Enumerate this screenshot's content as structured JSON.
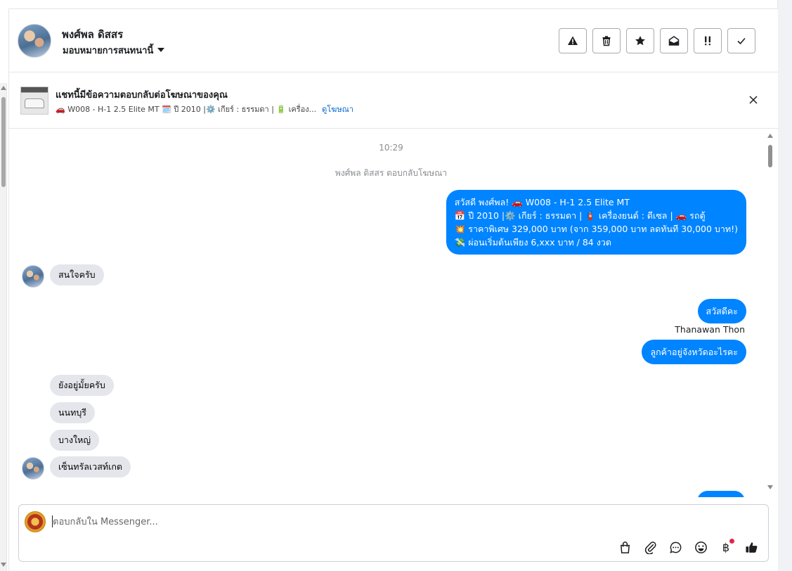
{
  "header": {
    "contact_name": "พงศ์พล ดิสสร",
    "assign_label": "มอบหมายการสนทนานี้",
    "actions": [
      {
        "name": "report-button",
        "icon": "warning-icon"
      },
      {
        "name": "delete-button",
        "icon": "trash-icon"
      },
      {
        "name": "star-button",
        "icon": "star-icon"
      },
      {
        "name": "mark-unread-button",
        "icon": "envelope-open-icon"
      },
      {
        "name": "follow-up-button",
        "icon": "double-exclamation-icon"
      },
      {
        "name": "done-button",
        "icon": "check-icon"
      }
    ]
  },
  "ad": {
    "title": "แชทนี้มีข้อความตอบกลับต่อโฆษณาของคุณ",
    "summary": "🚗 W008 - H-1 2.5 Elite MT 🗓️ ปี 2010 |⚙️ เกียร์ : ธรรมดา | 🔋 เครื่อง...",
    "link": "ดูโฆษณา"
  },
  "chat": {
    "time": "10:29",
    "system_message": "พงศ์พล ดิสสร ตอบกลับโฆษณา",
    "outgoing_1": {
      "lines": [
        "สวัสดี พงศ์พล! 🚗 W008 - H-1 2.5 Elite MT",
        "📅 ปี 2010 |⚙️ เกียร์ : ธรรมดา | 🧯 เครื่องยนต์ : ดีเซล | 🚗 รถตู้",
        "💥 ราคาพิเศษ 329,000 บาท (จาก 359,000 บาท ลดทันที 30,000 บาท!)",
        "💸 ผ่อนเริ่มต้นเพียง 6,xxx บาท / 84 งวด"
      ]
    },
    "incoming_1": "สนใจครับ",
    "outgoing_2": "สวัสดีคะ",
    "sender_name": "Thanawan Thon",
    "outgoing_3": "ลูกค้าอยู่จังหวัดอะไรคะ",
    "incoming_group": [
      "ยังอยู่มั้ยครับ",
      "นนทบุรี",
      "บางใหญ่",
      "เซ็นทรัลเวสท์เกต"
    ]
  },
  "composer": {
    "placeholder": "ตอบกลับใน Messenger...",
    "tools": [
      "shopping-bag-icon",
      "paperclip-icon",
      "chat-bubble-icon",
      "emoji-icon",
      "baht-icon",
      "thumbs-up-icon"
    ],
    "baht_symbol": "฿"
  },
  "colors": {
    "outgoing_bubble": "#0084ff",
    "incoming_bubble": "#e4e6eb",
    "link": "#0064d1",
    "notification_dot": "#e0284a"
  }
}
